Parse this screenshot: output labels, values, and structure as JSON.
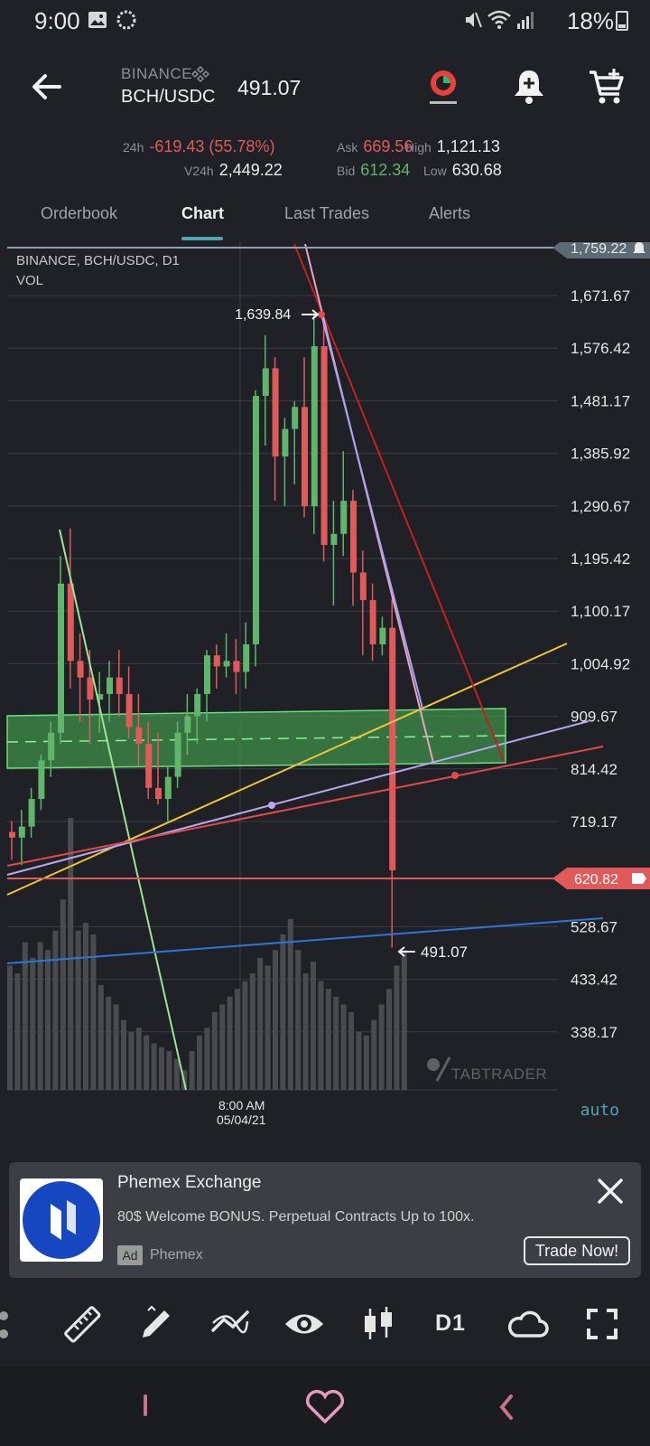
{
  "status_bar": {
    "time": "9:00",
    "battery": "18%"
  },
  "header": {
    "exchange": "BINANCE",
    "pair": "BCH/USDC",
    "last_price": "491.07"
  },
  "stats": {
    "change_label": "24h",
    "change_value": "-619.43 (55.78%)",
    "ask_label": "Ask",
    "ask_value": "669.56",
    "high_label": "High",
    "high_value": "1,121.13",
    "volume_label": "V24h",
    "volume_value": "2,449.22",
    "bid_label": "Bid",
    "bid_value": "612.34",
    "low_label": "Low",
    "low_value": "630.68"
  },
  "tabs": [
    {
      "label": "Orderbook"
    },
    {
      "label": "Chart"
    },
    {
      "label": "Last Trades"
    },
    {
      "label": "Alerts"
    }
  ],
  "chart": {
    "caption_line1": "BINANCE, BCH/USDC, D1",
    "caption_line2": "VOL",
    "watermark": "TABTRADER",
    "peak_label": "1,639.84",
    "last_label": "491.07",
    "alert_price": "1,759.22",
    "order_price": "620.82",
    "time_label_1": "8:00 AM",
    "time_label_2": "05/04/21",
    "auto_label": "auto",
    "colors": {
      "up": "#5fb56a",
      "down": "#e05a5a",
      "zone": "#3f8f4a"
    }
  },
  "chart_data": {
    "type": "candlestick",
    "title": "BINANCE, BCH/USDC, D1",
    "y_ticks": [
      "1,671.67",
      "1,576.42",
      "1,481.17",
      "1,385.92",
      "1,290.67",
      "1,195.42",
      "1,100.17",
      "1,004.92",
      "909.67",
      "814.42",
      "719.17",
      "620.82",
      "528.67",
      "433.42",
      "338.17"
    ],
    "x_ticks": [
      "8:00 AM 05/04/21"
    ],
    "series": [
      {
        "name": "VOL",
        "type": "bar"
      }
    ],
    "ylim": [
      338.17,
      1759.22
    ],
    "grid": true,
    "annotations": [
      "1,639.84",
      "491.07",
      "1,759.22",
      "620.82"
    ]
  },
  "ad": {
    "title": "Phemex Exchange",
    "body": "80$ Welcome BONUS. Perpetual Contracts Up to 100x.",
    "badge": "Ad",
    "brand": "Phemex",
    "cta": "Trade Now!"
  },
  "toolbar": {
    "timeframe": "D1"
  }
}
